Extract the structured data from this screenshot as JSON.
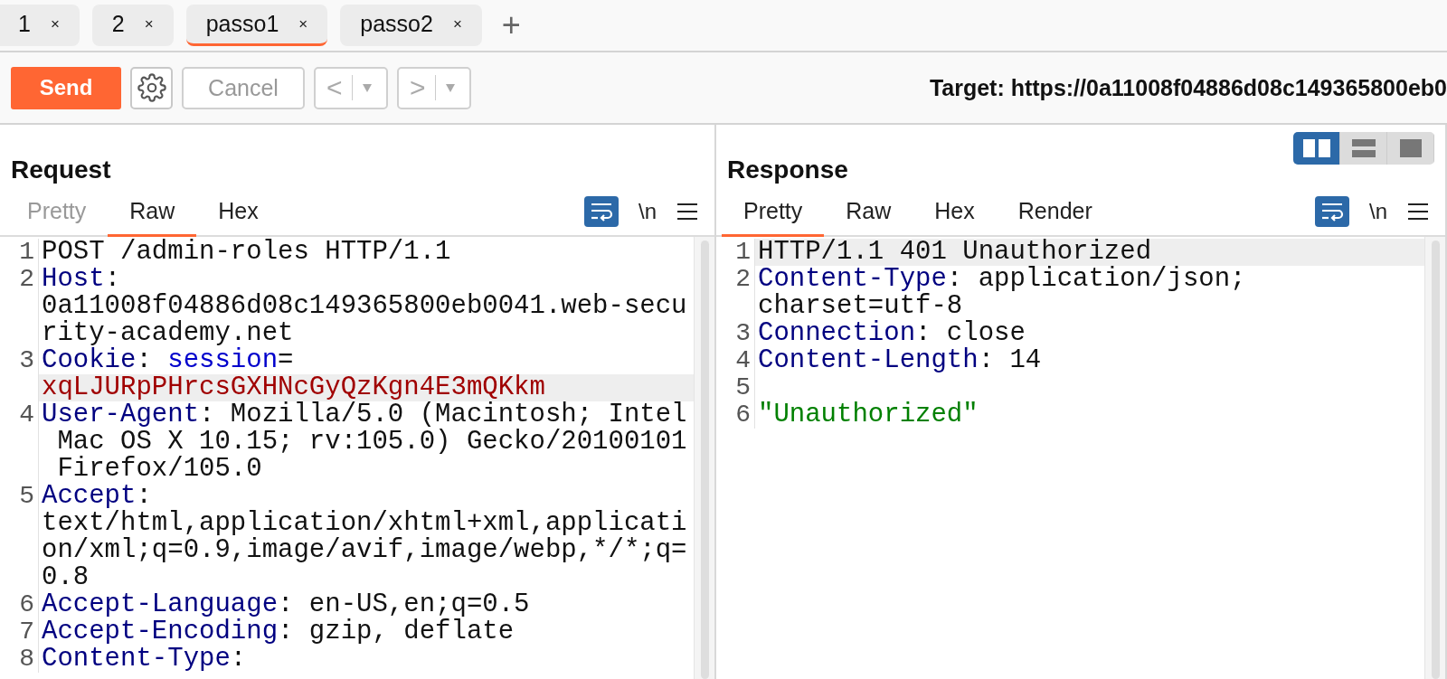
{
  "tabs": [
    {
      "label": "1",
      "close": "×",
      "selected": false
    },
    {
      "label": "2",
      "close": "×",
      "selected": false
    },
    {
      "label": "passo1",
      "close": "×",
      "selected": true
    },
    {
      "label": "passo2",
      "close": "×",
      "selected": false
    }
  ],
  "new_tab": "+",
  "toolbar": {
    "send": "Send",
    "cancel": "Cancel",
    "cancel_disabled": true,
    "back": "<",
    "forward": ">",
    "target": "Target: https://0a11008f04886d08c149365800eb0"
  },
  "request": {
    "title": "Request",
    "views": [
      {
        "label": "Pretty",
        "selected": false,
        "disabled": true
      },
      {
        "label": "Raw",
        "selected": true,
        "disabled": false
      },
      {
        "label": "Hex",
        "selected": false,
        "disabled": false
      }
    ],
    "wrap_on": true,
    "newline_label": "\\n",
    "lines": [
      {
        "number": "1",
        "rows": [
          {
            "highlighted": false,
            "parts": [
              {
                "kind": "plain",
                "text": "POST /admin-roles HTTP/1.1"
              }
            ]
          }
        ]
      },
      {
        "number": "2",
        "rows": [
          {
            "highlighted": false,
            "parts": [
              {
                "kind": "name",
                "text": "Host"
              },
              {
                "kind": "plain",
                "text": ":"
              }
            ]
          },
          {
            "highlighted": false,
            "parts": [
              {
                "kind": "plain",
                "text": "0a11008f04886d08c149365800eb0041.web-secu"
              }
            ]
          },
          {
            "highlighted": false,
            "parts": [
              {
                "kind": "plain",
                "text": "rity-academy.net"
              }
            ]
          }
        ]
      },
      {
        "number": "3",
        "rows": [
          {
            "highlighted": false,
            "parts": [
              {
                "kind": "name",
                "text": "Cookie"
              },
              {
                "kind": "plain",
                "text": ": "
              },
              {
                "kind": "param",
                "text": "session"
              },
              {
                "kind": "plain",
                "text": "="
              }
            ]
          },
          {
            "highlighted": true,
            "parts": [
              {
                "kind": "cookie",
                "text": "xqLJURpPHrcsGXHNcGyQzKgn4E3mQKkm"
              }
            ]
          }
        ]
      },
      {
        "number": "4",
        "rows": [
          {
            "highlighted": false,
            "parts": [
              {
                "kind": "name",
                "text": "User-Agent"
              },
              {
                "kind": "plain",
                "text": ": Mozilla/5.0 (Macintosh; Intel"
              }
            ]
          },
          {
            "highlighted": false,
            "parts": [
              {
                "kind": "plain",
                "text": " Mac OS X 10.15; rv:105.0) Gecko/20100101"
              }
            ]
          },
          {
            "highlighted": false,
            "parts": [
              {
                "kind": "plain",
                "text": " Firefox/105.0"
              }
            ]
          }
        ]
      },
      {
        "number": "5",
        "rows": [
          {
            "highlighted": false,
            "parts": [
              {
                "kind": "name",
                "text": "Accept"
              },
              {
                "kind": "plain",
                "text": ":"
              }
            ]
          },
          {
            "highlighted": false,
            "parts": [
              {
                "kind": "plain",
                "text": "text/html,application/xhtml+xml,applicati"
              }
            ]
          },
          {
            "highlighted": false,
            "parts": [
              {
                "kind": "plain",
                "text": "on/xml;q=0.9,image/avif,image/webp,*/*;q="
              }
            ]
          },
          {
            "highlighted": false,
            "parts": [
              {
                "kind": "plain",
                "text": "0.8"
              }
            ]
          }
        ]
      },
      {
        "number": "6",
        "rows": [
          {
            "highlighted": false,
            "parts": [
              {
                "kind": "name",
                "text": "Accept-Language"
              },
              {
                "kind": "plain",
                "text": ": en-US,en;q=0.5"
              }
            ]
          }
        ]
      },
      {
        "number": "7",
        "rows": [
          {
            "highlighted": false,
            "parts": [
              {
                "kind": "name",
                "text": "Accept-Encoding"
              },
              {
                "kind": "plain",
                "text": ": gzip, deflate"
              }
            ]
          }
        ]
      },
      {
        "number": "8",
        "rows": [
          {
            "highlighted": false,
            "parts": [
              {
                "kind": "name",
                "text": "Content-Type"
              },
              {
                "kind": "plain",
                "text": ":"
              }
            ]
          }
        ]
      }
    ]
  },
  "response": {
    "title": "Response",
    "layouts": [
      {
        "kind": "columns",
        "selected": true
      },
      {
        "kind": "rows",
        "selected": false
      },
      {
        "kind": "single",
        "selected": false
      }
    ],
    "views": [
      {
        "label": "Pretty",
        "selected": true,
        "disabled": false
      },
      {
        "label": "Raw",
        "selected": false,
        "disabled": false
      },
      {
        "label": "Hex",
        "selected": false,
        "disabled": false
      },
      {
        "label": "Render",
        "selected": false,
        "disabled": false
      }
    ],
    "wrap_on": true,
    "newline_label": "\\n",
    "lines": [
      {
        "number": "1",
        "rows": [
          {
            "highlighted": true,
            "parts": [
              {
                "kind": "plain",
                "text": "HTTP/1.1 401 Unauthorized"
              }
            ]
          }
        ]
      },
      {
        "number": "2",
        "rows": [
          {
            "highlighted": false,
            "parts": [
              {
                "kind": "name",
                "text": "Content-Type"
              },
              {
                "kind": "plain",
                "text": ": application/json;"
              }
            ]
          },
          {
            "highlighted": false,
            "parts": [
              {
                "kind": "plain",
                "text": "charset=utf-8"
              }
            ]
          }
        ]
      },
      {
        "number": "3",
        "rows": [
          {
            "highlighted": false,
            "parts": [
              {
                "kind": "name",
                "text": "Connection"
              },
              {
                "kind": "plain",
                "text": ": close"
              }
            ]
          }
        ]
      },
      {
        "number": "4",
        "rows": [
          {
            "highlighted": false,
            "parts": [
              {
                "kind": "name",
                "text": "Content-Length"
              },
              {
                "kind": "plain",
                "text": ": 14"
              }
            ]
          }
        ]
      },
      {
        "number": "5",
        "rows": [
          {
            "highlighted": false
          }
        ]
      },
      {
        "number": "6",
        "rows": [
          {
            "highlighted": false,
            "parts": [
              {
                "kind": "string",
                "text": "\"Unauthorized\""
              }
            ]
          }
        ]
      }
    ]
  }
}
